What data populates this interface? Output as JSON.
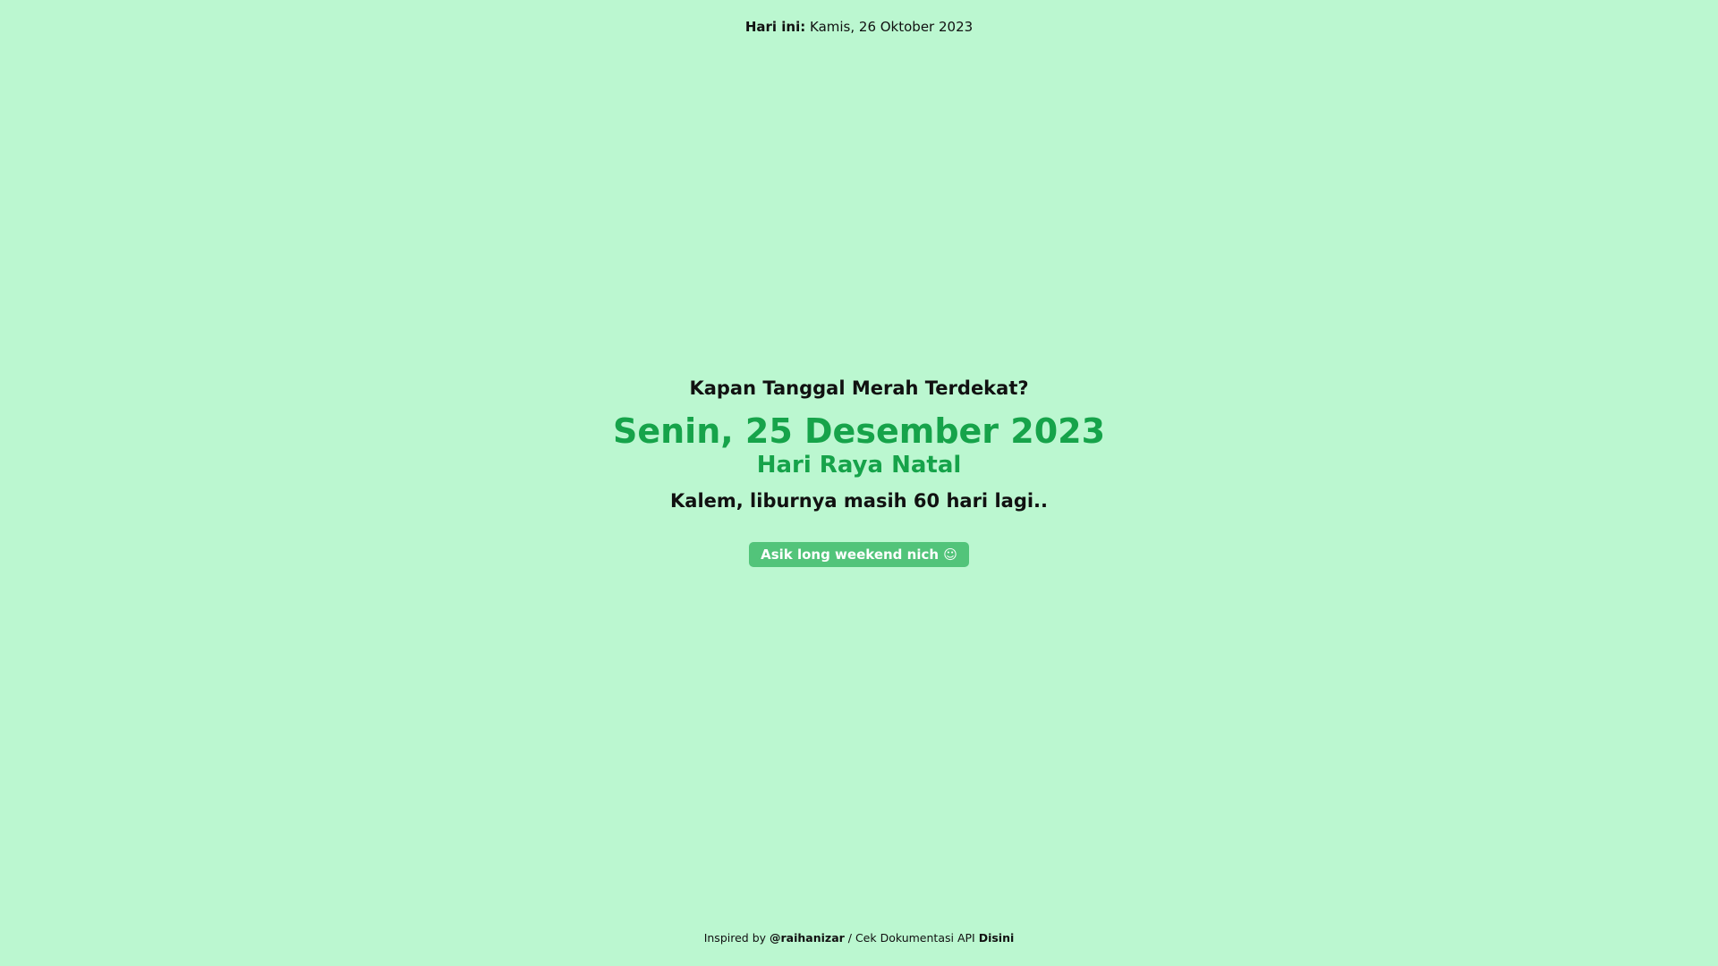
{
  "today": {
    "label": "Hari ini:",
    "value": "Kamis, 26 Oktober 2023"
  },
  "main": {
    "question": "Kapan Tanggal Merah Terdekat?",
    "holiday_date": "Senin, 25 Desember 2023",
    "holiday_name": "Hari Raya Natal",
    "countdown": "Kalem, liburnya masih 60 hari lagi..",
    "badge": "Asik long weekend nich ☺"
  },
  "footer": {
    "inspired_text": "Inspired by ",
    "author": "@raihanizar",
    "separator": " / Cek Dokumentasi API ",
    "docs_link": "Disini"
  },
  "colors": {
    "background": "#bbf7d0",
    "accent": "#16a34a",
    "badge": "#52c47a"
  }
}
